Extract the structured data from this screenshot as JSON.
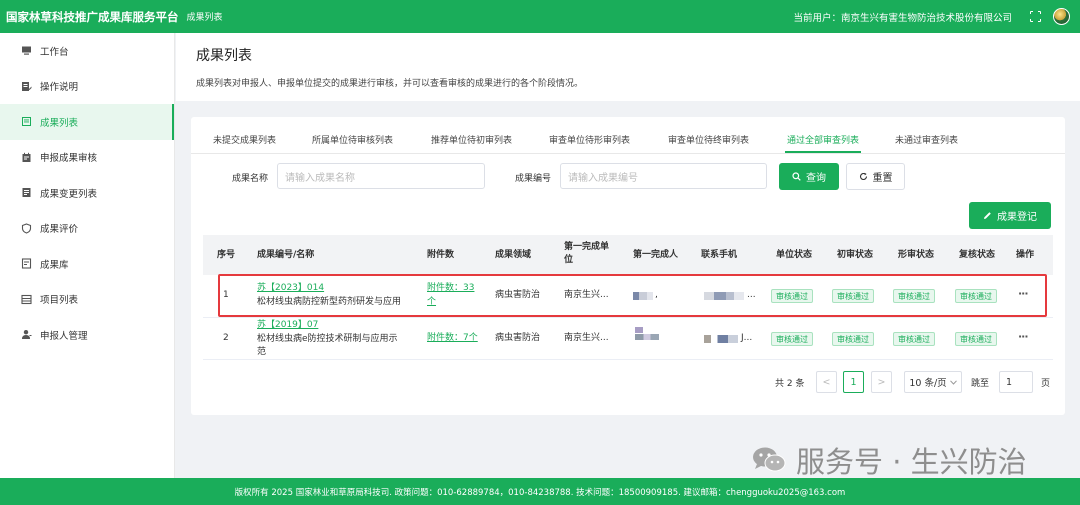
{
  "header": {
    "brand": "国家林草科技推广成果库服务平台",
    "breadcrumb": "成果列表",
    "user_label": "当前用户：南京生兴有害生物防治技术股份有限公司",
    "colors": {
      "primary": "#1aad5a",
      "highlight": "#e5393d"
    }
  },
  "sidebar": {
    "items": [
      {
        "label": "工作台",
        "icon": "monitor-icon"
      },
      {
        "label": "操作说明",
        "icon": "document-edit-icon"
      },
      {
        "label": "成果列表",
        "icon": "list-icon",
        "active": true
      },
      {
        "label": "申报成果审核",
        "icon": "calendar-check-icon"
      },
      {
        "label": "成果变更列表",
        "icon": "document-list-icon"
      },
      {
        "label": "成果评价",
        "icon": "shield-icon"
      },
      {
        "label": "成果库",
        "icon": "checklist-icon"
      },
      {
        "label": "项目列表",
        "icon": "table-icon"
      },
      {
        "label": "申报人管理",
        "icon": "user-icon"
      }
    ]
  },
  "page": {
    "title": "成果列表",
    "description": "成果列表对申报人、申报单位提交的成果进行审核，并可以查看审核的成果进行的各个阶段情况。"
  },
  "tabs": [
    "未提交成果列表",
    "所属单位待审核列表",
    "推荐单位待初审列表",
    "审查单位待形审列表",
    "审查单位待终审列表",
    "通过全部审查列表",
    "未通过审查列表"
  ],
  "active_tab": "通过全部审查列表",
  "search": {
    "name_label": "成果名称",
    "name_placeholder": "请输入成果名称",
    "code_label": "成果编号",
    "code_placeholder": "请输入成果编号",
    "query_button": "查询",
    "reset_button": "重置",
    "register_button": "成果登记"
  },
  "table": {
    "headers": {
      "index": "序号",
      "code_name": "成果编号/名称",
      "attachments": "附件数",
      "field": "成果领域",
      "first_unit": "第一完成单位",
      "first_person": "第一完成人",
      "phone": "联系手机",
      "unit_status": "单位状态",
      "initial_status": "初审状态",
      "formal_status": "形审状态",
      "review_status": "复核状态",
      "actions": "操作"
    },
    "rows": [
      {
        "index": "1",
        "code": "苏【2023】014",
        "name": "松材线虫病防控新型药剂研发与应用",
        "attachments_line1": "附件数：33",
        "attachments_line2": "个",
        "field": "病虫害防治",
        "first_unit": "南京生兴...",
        "person_suffix": ",",
        "phone_suffix": "...",
        "unit_status": "审核通过",
        "initial_status": "审核通过",
        "formal_status": "审核通过",
        "review_status": "审核通过",
        "actions": "···"
      },
      {
        "index": "2",
        "code": "苏【2019】07",
        "name_line1": "松材线虫病e防控技术研制与应用示",
        "name_line2": "范",
        "attachments": "附件数：7个",
        "field": "病虫害防治",
        "first_unit": "南京生兴...",
        "phone_suffix": "J...",
        "unit_status": "审核通过",
        "initial_status": "审核通过",
        "formal_status": "审核通过",
        "review_status": "审核通过",
        "actions": "···"
      }
    ]
  },
  "pagination": {
    "total": "共 2 条",
    "prev": "<",
    "current_page": "1",
    "next": ">",
    "page_size": "10 条/页",
    "jump_label": "跳至",
    "jump_value": "1",
    "page_unit": "页"
  },
  "watermark": "服务号 · 生兴防治",
  "footer": "版权所有 2025 国家林业和草原局科技司. 政策问题：010-62889784，010-84238788. 技术问题：18500909185. 建议邮箱：chengguoku2025@163.com"
}
